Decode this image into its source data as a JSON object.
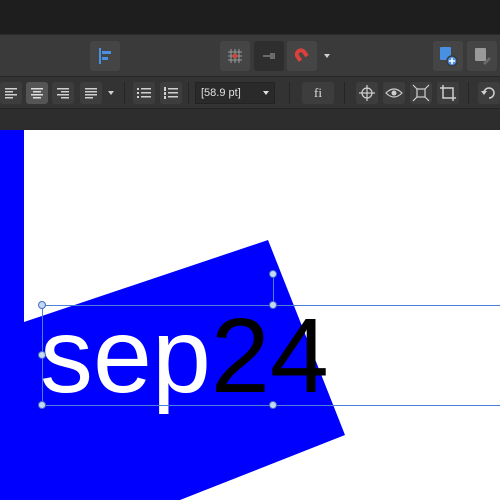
{
  "context_toolbar": {
    "font_size_value": "[58.9 pt]",
    "ligature_label": "fi"
  },
  "canvas": {
    "text_white_part": "sep",
    "text_black_part": "24"
  },
  "colors": {
    "shape_fill": "#0000ff",
    "selection": "#4c7fd9",
    "toolbar_bg": "#3a3a3a",
    "accent_blue": "#4a90e2",
    "magnet_red": "#d9413a"
  }
}
